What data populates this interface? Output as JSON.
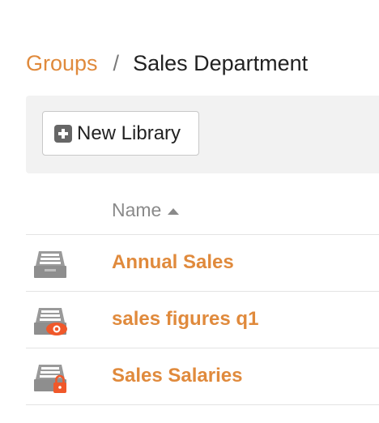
{
  "breadcrumb": {
    "parent": "Groups",
    "separator": "/",
    "current": "Sales Department"
  },
  "toolbar": {
    "new_library_label": "New Library"
  },
  "table": {
    "column_name": "Name",
    "sort_direction": "ascending",
    "rows": [
      {
        "name": "Annual Sales",
        "icon": "library-icon"
      },
      {
        "name": "sales figures q1",
        "icon": "library-shared-view-icon"
      },
      {
        "name": "Sales Salaries",
        "icon": "library-locked-icon"
      }
    ]
  },
  "colors": {
    "accent": "#e08a3c",
    "text": "#222222",
    "muted": "#8a8a8a",
    "toolbar_bg": "#f2f2f2",
    "icon_gray": "#8e8e8e",
    "badge_orange": "#f0582a"
  }
}
